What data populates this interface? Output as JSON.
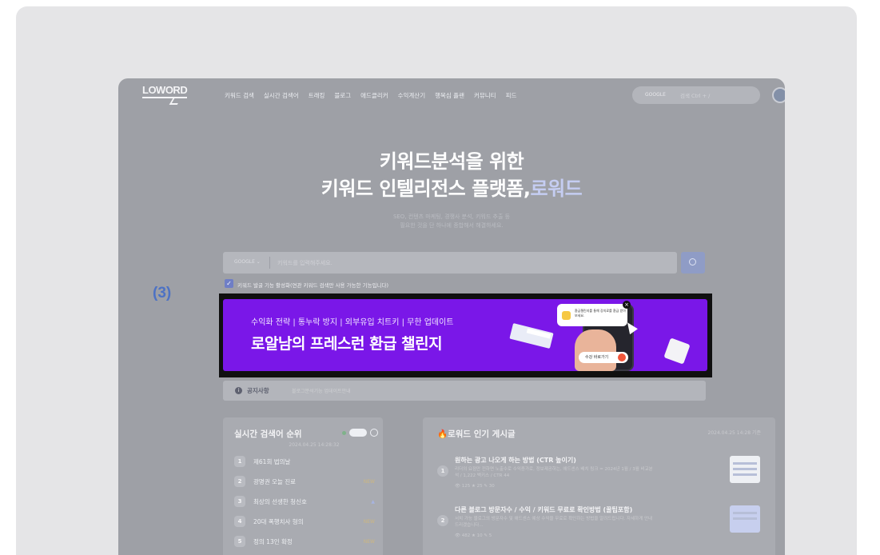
{
  "marker": "(3)",
  "nav": {
    "logo": "LOWORD",
    "menu": [
      "키워드 검색",
      "실시간 검색어",
      "트래킹",
      "블로그",
      "애드클리커",
      "수익계산기",
      "행복심 플랜",
      "커뮤니티",
      "피드"
    ],
    "search_engine": "GOOGLE",
    "search_placeholder": "검색 Ctrl + /"
  },
  "hero": {
    "line1": "키워드분석을 위한",
    "line2_main": "키워드 인텔리전스 플랫폼,",
    "line2_accent": "로워드",
    "sub1": "SEO, 컨텐츠 마케팅, 경쟁사 분석, 키워드 추출 등",
    "sub2": "필요한 것을 단 하나에 종합해서 해결하세요."
  },
  "search": {
    "engine": "GOOGLE",
    "placeholder": "키워드를 입력해주세요.",
    "checkbox_label": "키워드 발굴 기능 활성화(연관 키워드 검색만 사용 가능한 기능입니다)"
  },
  "banner": {
    "top_text": "수익화 전략 | 통누락 방지 | 외부유입 치트키 | 무한 업데이트",
    "main_text": "로알남의 프레스런 환급 챌린지",
    "card_text": "환급챌린지를 통해 강의료를 환급 받아 보세요.",
    "pill_text": "수강 바로가기"
  },
  "notice": {
    "icon": "i",
    "label": "공지사항",
    "text": "블로그분석기능 업데이트안내"
  },
  "realtime": {
    "title": "실시간 검색어 순위",
    "updated": "2024.04.25 14:28:32",
    "items": [
      {
        "rank": "1",
        "keyword": "제61회 법의날",
        "badge": ""
      },
      {
        "rank": "2",
        "keyword": "광명권 오늘 진료",
        "badge": "NEW"
      },
      {
        "rank": "3",
        "keyword": "최상의 선생한 청신호",
        "badge": "▲"
      },
      {
        "rank": "4",
        "keyword": "20대 폭행치사 형의",
        "badge": "NEW"
      },
      {
        "rank": "5",
        "keyword": "정의 13인 확정",
        "badge": "NEW"
      }
    ]
  },
  "popular": {
    "title": "🔥로워드 인기 게시글",
    "date": "2024.04.25 14:28 기준",
    "posts": [
      {
        "num": "1",
        "title": "원하는 광고 나오게 하는 방법 (CTR 높이기)",
        "desc": "리더의 요점만 전하면 노출수로 수익증가로, 정보제공하는, 애드센스 배치 링크 = 2024년 1월 / 3월 비교분석 / 1,222 백키스 / CTR 44",
        "meta": "👁 125  ★ 25  ✎ 30"
      },
      {
        "num": "2",
        "title": "다른 블로그 방문자수 / 수익 / 키워드 무료로 확인방법 (꿀팁포함)",
        "desc": "서치 가능 블로그의 방문자수 및 애드센스 예상 수익을 무료로 확인하는 방법을 알려드립니다. 자세하게 안내드리겠습니다...",
        "meta": "👁 482  ★ 10  ✎ 5"
      }
    ]
  }
}
